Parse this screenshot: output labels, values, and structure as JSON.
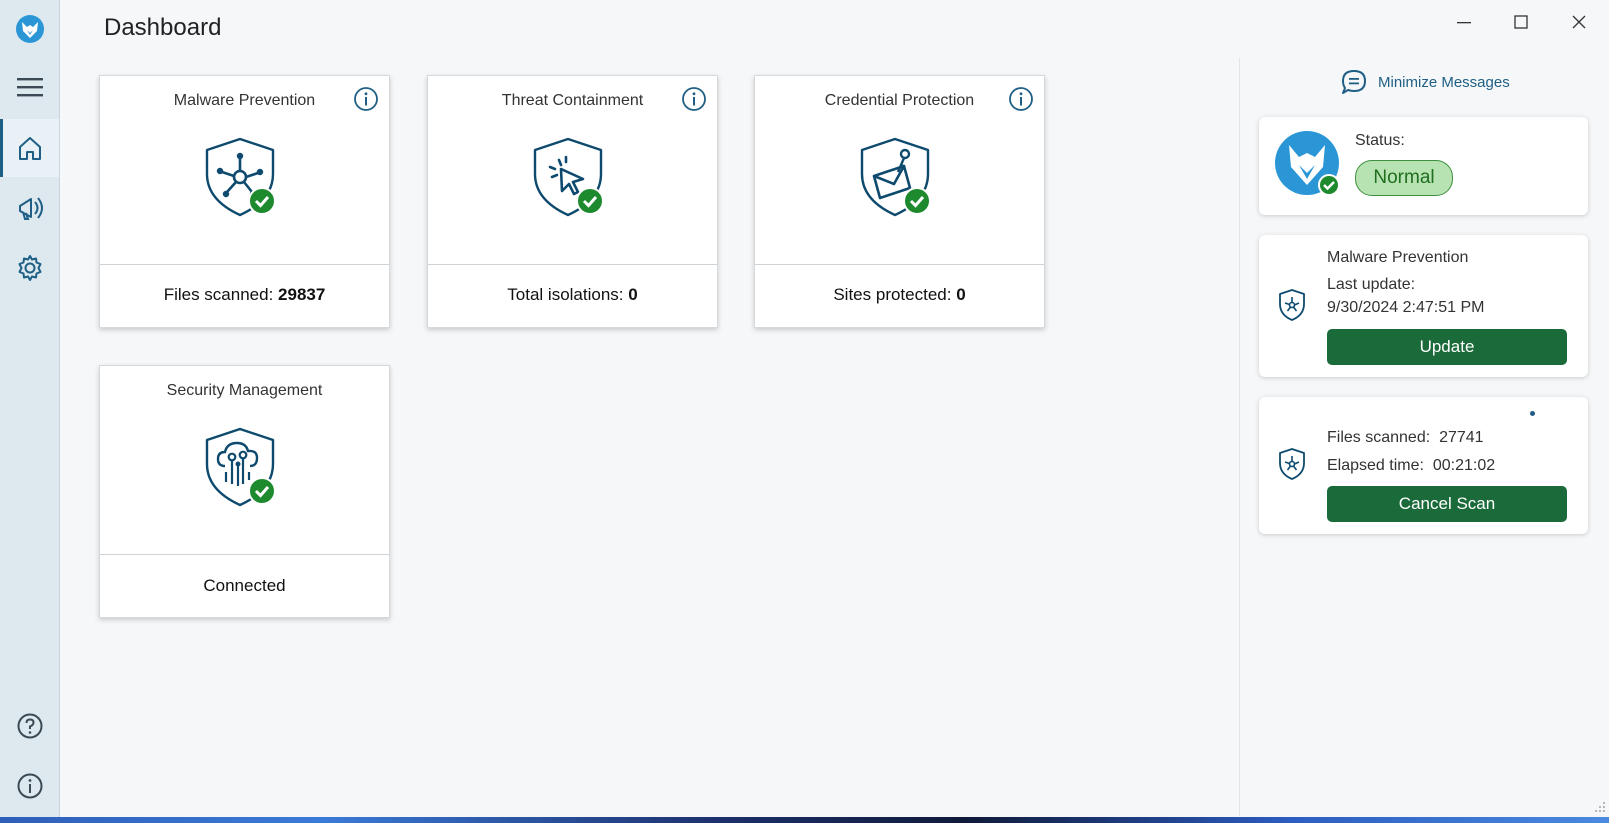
{
  "window": {
    "title": "Dashboard",
    "controls": [
      "minimize-icon",
      "maximize-icon",
      "close-icon"
    ]
  },
  "sidebar": {
    "logo_icon": "fox-logo-icon",
    "items": [
      {
        "name": "menu",
        "icon": "hamburger-menu-icon"
      },
      {
        "name": "home",
        "icon": "home-icon",
        "active": true
      },
      {
        "name": "messages",
        "icon": "megaphone-icon"
      },
      {
        "name": "settings",
        "icon": "gear-icon"
      },
      {
        "name": "help",
        "icon": "help-icon"
      },
      {
        "name": "about",
        "icon": "info-icon"
      }
    ]
  },
  "cards": [
    {
      "title": "Malware Prevention",
      "icon": "malware-shield-icon",
      "footer_label": "Files scanned: ",
      "footer_value": "29837",
      "has_info": true
    },
    {
      "title": "Threat Containment",
      "icon": "cursor-shield-icon",
      "footer_label": "Total isolations: ",
      "footer_value": "0",
      "has_info": true
    },
    {
      "title": "Credential Protection",
      "icon": "envelope-shield-icon",
      "footer_label": "Sites protected: ",
      "footer_value": "0",
      "has_info": true
    },
    {
      "title": "Security Management",
      "icon": "cloud-shield-icon",
      "footer_label": "Connected",
      "footer_value": "",
      "has_info": false
    }
  ],
  "right_panel": {
    "minimize_messages_label": "Minimize Messages",
    "status": {
      "label": "Status:",
      "value": "Normal"
    },
    "malware_update": {
      "title": "Malware Prevention",
      "last_update_label": "Last update:",
      "last_update_value": "9/30/2024 2:47:51 PM",
      "button_label": "Update"
    },
    "scan": {
      "files_scanned_label": "Files scanned:",
      "files_scanned_value": "27741",
      "elapsed_label": "Elapsed time:",
      "elapsed_value": "00:21:02",
      "button_label": "Cancel Scan"
    }
  },
  "colors": {
    "accent": "#1f5f86",
    "check_green": "#1e8a2e",
    "button_green": "#1b6b3a",
    "status_pill": "#b7e2b1",
    "sidebar_bg": "#dde8ef"
  }
}
